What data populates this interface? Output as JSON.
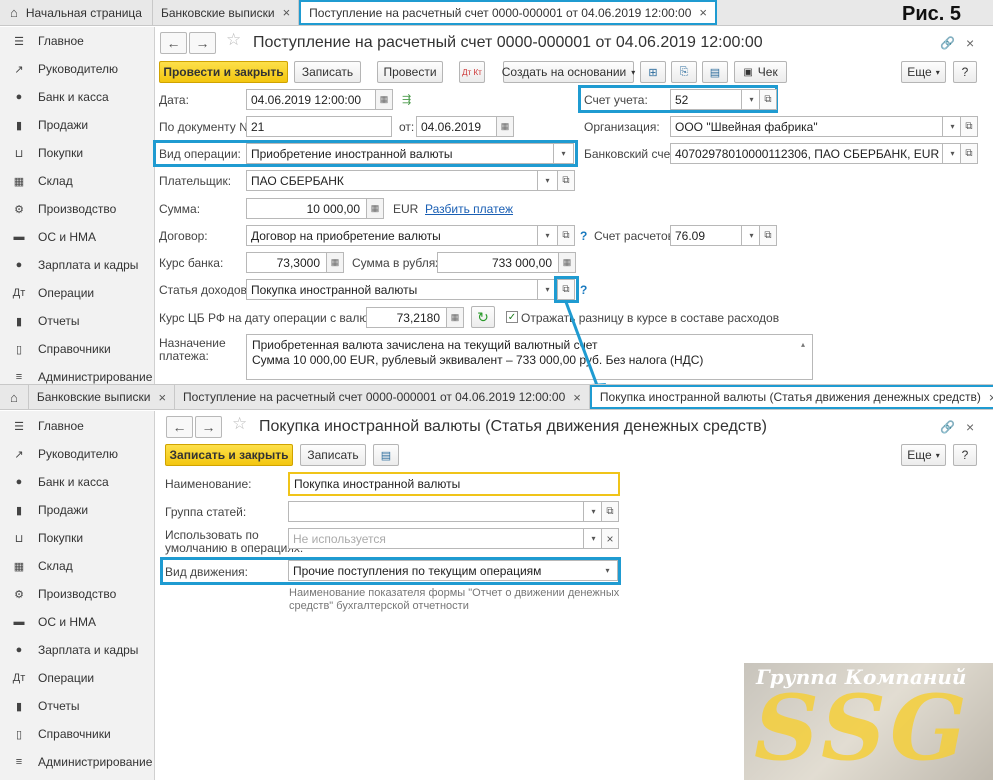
{
  "figure_label": "Рис. 5",
  "window1": {
    "tabs": [
      "Начальная страница",
      "Банковские выписки",
      "Поступление на расчетный счет 0000-000001 от 04.06.2019 12:00:00"
    ],
    "sidebar": [
      "Главное",
      "Руководителю",
      "Банк и касса",
      "Продажи",
      "Покупки",
      "Склад",
      "Производство",
      "ОС и НМА",
      "Зарплата и кадры",
      "Операции",
      "Отчеты",
      "Справочники",
      "Администрирование"
    ],
    "title": "Поступление на расчетный счет 0000-000001 от 04.06.2019 12:00:00",
    "toolbar": {
      "post_close": "Провести и закрыть",
      "save": "Записать",
      "post": "Провести",
      "dt_kt": "Дт Кт",
      "create_based": "Создать на основании",
      "check": "Чек",
      "more": "Еще",
      "help": "?"
    },
    "form": {
      "date_label": "Дата:",
      "date_value": "04.06.2019 12:00:00",
      "docnum_label": "По документу №:",
      "docnum_value": "21",
      "from_label": "от:",
      "from_value": "04.06.2019",
      "optype_label": "Вид операции:",
      "optype_value": "Приобретение иностранной валюты",
      "payer_label": "Плательщик:",
      "payer_value": "ПАО СБЕРБАНК",
      "sum_label": "Сумма:",
      "sum_value": "10 000,00",
      "currency": "EUR",
      "split_link": "Разбить платеж",
      "contract_label": "Договор:",
      "contract_value": "Договор на приобретение валюты",
      "rate_label": "Курс банка:",
      "rate_value": "73,3000",
      "rub_label": "Сумма в рублях:",
      "rub_value": "733 000,00",
      "income_label": "Статья доходов:",
      "income_value": "Покупка иностранной валюты",
      "cbr_label": "Курс ЦБ РФ на дату операции с валютой:",
      "cbr_value": "73,2180",
      "reflect_label": "Отражать разницу в курсе в составе расходов",
      "purpose_label_1": "Назначение",
      "purpose_label_2": "платежа:",
      "purpose_line1": "Приобретенная валюта зачислена на текущий валютный счет",
      "purpose_line2": "Сумма 10 000,00 EUR, рублевый эквивалент – 733 000,00 руб. Без налога (НДС)",
      "account_label": "Счет учета:",
      "account_value": "52",
      "org_label": "Организация:",
      "org_value": "ООО \"Швейная фабрика\"",
      "bank_label": "Банковский счет:",
      "bank_value": "40702978010000112306, ПАО СБЕРБАНК, EUR",
      "settle_label": "Счет расчетов:",
      "settle_value": "76.09"
    }
  },
  "window2": {
    "tabs": [
      "Банковские выписки",
      "Поступление на расчетный счет 0000-000001 от 04.06.2019 12:00:00",
      "Покупка иностранной валюты (Статья движения денежных средств)"
    ],
    "sidebar": [
      "Главное",
      "Руководителю",
      "Банк и касса",
      "Продажи",
      "Покупки",
      "Склад",
      "Производство",
      "ОС и НМА",
      "Зарплата и кадры",
      "Операции",
      "Отчеты",
      "Справочники",
      "Администрирование"
    ],
    "title": "Покупка иностранной валюты (Статья движения денежных средств)",
    "toolbar": {
      "save_close": "Записать и закрыть",
      "save": "Записать",
      "more": "Еще",
      "help": "?"
    },
    "form": {
      "name_label": "Наименование:",
      "name_value": "Покупка иностранной валюты",
      "group_label": "Группа статей:",
      "default_label_1": "Использовать по",
      "default_label_2": "умолчанию в операциях:",
      "default_placeholder": "Не используется",
      "movement_label": "Вид движения:",
      "movement_value": "Прочие поступления по текущим операциям",
      "hint_1": "Наименование показателя формы \"Отчет о движении денежных",
      "hint_2": "средств\" бухгалтерской отчетности"
    }
  },
  "logo": {
    "top": "Группа Компаний",
    "main": "SSG"
  },
  "colors": {
    "accent": "#1f9bd1",
    "primary_button": "#f3c60f",
    "link": "#1a5fb4"
  },
  "icons": {
    "dropdown": "▾",
    "open": "⧉",
    "close": "×",
    "back": "←",
    "forward": "→",
    "star": "☆",
    "link": "🔗",
    "refresh": "↻"
  }
}
